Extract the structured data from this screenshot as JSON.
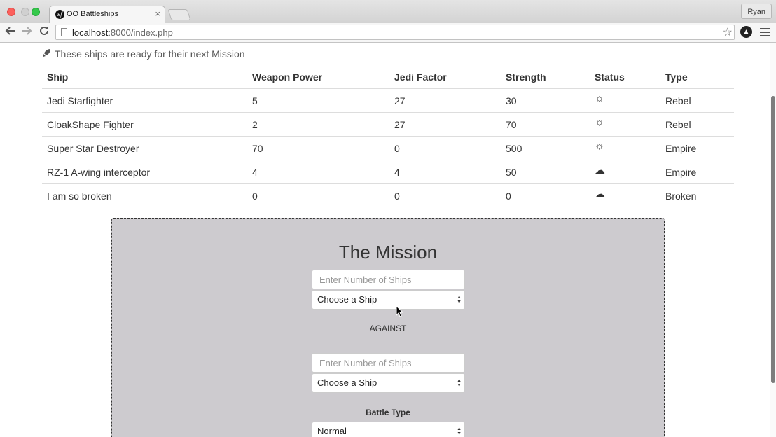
{
  "browser": {
    "tab_title": "OO Battleships",
    "tab_close": "×",
    "favicon_glyph": "sf",
    "profile_name": "Ryan",
    "url_host": "localhost",
    "url_path": ":8000/index.php"
  },
  "page": {
    "ready_text": "These ships are ready for their next Mission",
    "table": {
      "headers": [
        "Ship",
        "Weapon Power",
        "Jedi Factor",
        "Strength",
        "Status",
        "Type"
      ],
      "rows": [
        {
          "ship": "Jedi Starfighter",
          "weapon_power": "5",
          "jedi_factor": "27",
          "strength": "30",
          "status_icon": "sun-icon",
          "status_glyph": "☼",
          "type": "Rebel"
        },
        {
          "ship": "CloakShape Fighter",
          "weapon_power": "2",
          "jedi_factor": "27",
          "strength": "70",
          "status_icon": "sun-icon",
          "status_glyph": "☼",
          "type": "Rebel"
        },
        {
          "ship": "Super Star Destroyer",
          "weapon_power": "70",
          "jedi_factor": "0",
          "strength": "500",
          "status_icon": "sun-icon",
          "status_glyph": "☼",
          "type": "Empire"
        },
        {
          "ship": "RZ-1 A-wing interceptor",
          "weapon_power": "4",
          "jedi_factor": "4",
          "strength": "50",
          "status_icon": "cloud-icon",
          "status_glyph": "☁",
          "type": "Empire"
        },
        {
          "ship": "I am so broken",
          "weapon_power": "0",
          "jedi_factor": "0",
          "strength": "0",
          "status_icon": "cloud-icon",
          "status_glyph": "☁",
          "type": "Broken"
        }
      ]
    },
    "mission": {
      "title": "The Mission",
      "ship1_count_placeholder": "Enter Number of Ships",
      "ship1_select_value": "Choose a Ship",
      "against_label": "AGAINST",
      "ship2_count_placeholder": "Enter Number of Ships",
      "ship2_select_value": "Choose a Ship",
      "battle_type_label": "Battle Type",
      "battle_type_value": "Normal"
    }
  },
  "colors": {
    "mission_bg": "#cdcbcf",
    "text": "#333333"
  }
}
